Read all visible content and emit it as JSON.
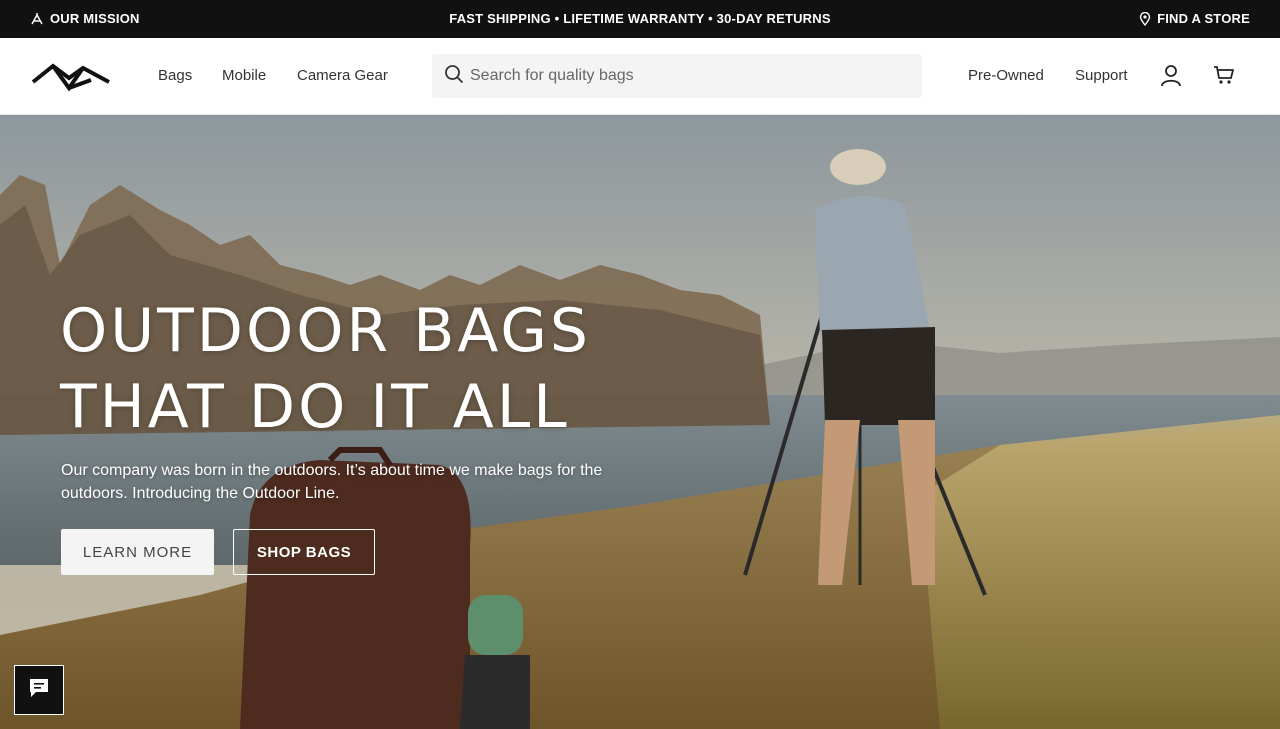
{
  "topbar": {
    "mission": "OUR MISSION",
    "promo": "FAST SHIPPING • LIFETIME WARRANTY • 30-DAY RETURNS",
    "store": "FIND A STORE"
  },
  "header": {
    "nav": [
      "Bags",
      "Mobile",
      "Camera Gear"
    ],
    "search_placeholder": "Search for quality bags",
    "right_nav": [
      "Pre-Owned",
      "Support"
    ]
  },
  "hero": {
    "headline_line1": "OUTDOOR BAGS",
    "headline_line2": "THAT DO IT ALL",
    "subcopy_line1": "Our company was born in the outdoors. It’s about time we make bags for the",
    "subcopy_line2": "outdoors. Introducing the Outdoor Line.",
    "learn_more": "LEARN MORE",
    "shop_bags": "SHOP BAGS"
  },
  "icons": {
    "mission": "mission-icon",
    "store": "location-pin-icon",
    "search": "search-icon",
    "account": "user-icon",
    "cart": "cart-icon",
    "chat": "chat-icon"
  },
  "colors": {
    "topbar_bg": "#111111",
    "button_light": "#f4f4f4"
  }
}
